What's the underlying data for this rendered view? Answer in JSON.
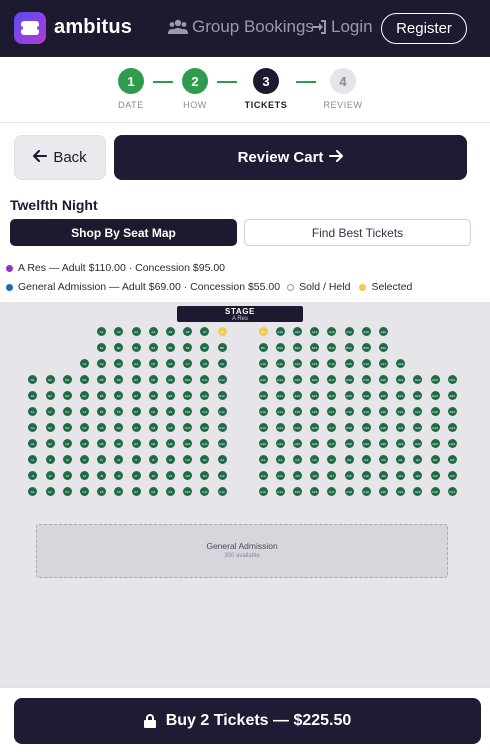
{
  "header": {
    "brand": "ambitus",
    "nav_group_bookings": "Group Bookings",
    "nav_login": "Login",
    "register": "Register"
  },
  "stepper": {
    "steps": [
      {
        "number": "1",
        "label": "DATE",
        "status": "complete"
      },
      {
        "number": "2",
        "label": "HOW",
        "status": "complete"
      },
      {
        "number": "3",
        "label": "TICKETS",
        "status": "active"
      },
      {
        "number": "4",
        "label": "REVIEW",
        "status": "upcoming"
      }
    ]
  },
  "actions": {
    "back": "Back",
    "review_cart": "Review Cart"
  },
  "show": {
    "title": "Twelfth Night"
  },
  "tabs": {
    "seat_map": "Shop By Seat Map",
    "best_tickets": "Find Best Tickets"
  },
  "legend": {
    "a_res": "A Res — Adult $110.00 · Concession $95.00",
    "general": "General Admission — Adult $69.00 · Concession $55.00",
    "sold": "Sold / Held",
    "selected": "Selected"
  },
  "colors": {
    "a_res": "#9b2fc9",
    "general": "#2266b8",
    "seat_available": "#1f6b45",
    "seat_selected": "#f2c94c",
    "complete_step": "#2e9b4f",
    "primary": "#1e1b35"
  },
  "seat_map": {
    "stage_label": "STAGE",
    "stage_sub": "A Res",
    "ga_label": "General Admission",
    "ga_available": "300 available",
    "rows": [
      {
        "row": "A",
        "left": [
          "A1",
          "A2",
          "A3",
          "A4",
          "A5",
          "A6",
          "A7",
          "A8"
        ],
        "right": [
          "A9",
          "A10",
          "A11",
          "A12",
          "A13",
          "A14",
          "A15",
          "A16"
        ],
        "selected": [
          "A8",
          "A9"
        ]
      },
      {
        "row": "B",
        "left": [
          "B1",
          "B2",
          "B3",
          "B4",
          "B5",
          "B6",
          "B7",
          "B8"
        ],
        "right": [
          "B9",
          "B10",
          "B11",
          "B12",
          "B13",
          "B14",
          "B15",
          "B16"
        ]
      },
      {
        "row": "C",
        "left": [
          "C1",
          "C2",
          "C3",
          "C4",
          "C5",
          "C6",
          "C7",
          "C8",
          "C9"
        ],
        "right": [
          "C10",
          "C11",
          "C12",
          "C13",
          "C14",
          "C15",
          "C16",
          "C17",
          "C18"
        ]
      },
      {
        "row": "D",
        "left": [
          "D1",
          "D2",
          "D3",
          "D4",
          "D5",
          "D6",
          "D7",
          "D8",
          "D9",
          "D10",
          "D11",
          "D12"
        ],
        "right": [
          "D13",
          "D14",
          "D15",
          "D16",
          "D17",
          "D18",
          "D19",
          "D20",
          "D21",
          "D22",
          "D23",
          "D24"
        ]
      },
      {
        "row": "E",
        "left": [
          "E1",
          "E2",
          "E3",
          "E4",
          "E5",
          "E6",
          "E7",
          "E8",
          "E9",
          "E10",
          "E11",
          "E12"
        ],
        "right": [
          "E13",
          "E14",
          "E15",
          "E16",
          "E17",
          "E18",
          "E19",
          "E20",
          "E21",
          "E22",
          "E23",
          "E24"
        ]
      },
      {
        "row": "F",
        "left": [
          "F1",
          "F2",
          "F3",
          "F4",
          "F5",
          "F6",
          "F7",
          "F8",
          "F9",
          "F10",
          "F11",
          "F12"
        ],
        "right": [
          "F13",
          "F14",
          "F15",
          "F16",
          "F17",
          "F18",
          "F19",
          "F20",
          "F21",
          "F22",
          "F23",
          "F24"
        ]
      },
      {
        "row": "G",
        "left": [
          "G1",
          "G2",
          "G3",
          "G4",
          "G5",
          "G6",
          "G7",
          "G8",
          "G9",
          "G10",
          "G11",
          "G12"
        ],
        "right": [
          "G13",
          "G14",
          "G15",
          "G16",
          "G17",
          "G18",
          "G19",
          "G20",
          "G21",
          "G22",
          "G23",
          "G24"
        ]
      },
      {
        "row": "H",
        "left": [
          "H1",
          "H2",
          "H3",
          "H4",
          "H5",
          "H6",
          "H7",
          "H8",
          "H9",
          "H10",
          "H11",
          "H12"
        ],
        "right": [
          "H13",
          "H14",
          "H15",
          "H16",
          "H17",
          "H18",
          "H19",
          "H20",
          "H21",
          "H22",
          "H23",
          "H24"
        ]
      },
      {
        "row": "I",
        "left": [
          "I1",
          "I2",
          "I3",
          "I4",
          "I5",
          "I6",
          "I7",
          "I8",
          "I9",
          "I10",
          "I11",
          "I12"
        ],
        "right": [
          "I13",
          "I14",
          "I15",
          "I16",
          "I17",
          "I18",
          "I19",
          "I20",
          "I21",
          "I22",
          "I23",
          "I24"
        ]
      },
      {
        "row": "J",
        "left": [
          "J1",
          "J2",
          "J3",
          "J4",
          "J5",
          "J6",
          "J7",
          "J8",
          "J9",
          "J10",
          "J11",
          "J12"
        ],
        "right": [
          "J13",
          "J14",
          "J15",
          "J16",
          "J17",
          "J18",
          "J19",
          "J20",
          "J21",
          "J22",
          "J23",
          "J24"
        ]
      },
      {
        "row": "K",
        "left": [
          "K1",
          "K2",
          "K3",
          "K4",
          "K5",
          "K6",
          "K7",
          "K8",
          "K9",
          "K10",
          "K11",
          "K12"
        ],
        "right": [
          "K13",
          "K14",
          "K15",
          "K16",
          "K17",
          "K18",
          "K19",
          "K20",
          "K21",
          "K22",
          "K23",
          "K24"
        ]
      }
    ]
  },
  "buy": {
    "label": "Buy 2 Tickets — $225.50"
  }
}
